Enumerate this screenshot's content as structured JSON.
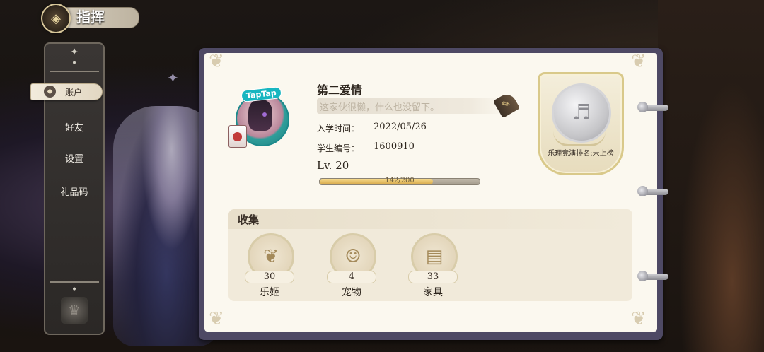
{
  "header": {
    "title": "指挥",
    "emblem_icon": "compass-emblem-icon"
  },
  "menu": {
    "items": [
      {
        "label": "账户",
        "active": true
      },
      {
        "label": "好友",
        "active": false
      },
      {
        "label": "设置",
        "active": false
      },
      {
        "label": "礼品码",
        "active": false
      }
    ]
  },
  "profile": {
    "avatar_badge": "TapTap",
    "name": "第二爱情",
    "signature_placeholder": "这家伙很懒，什么也没留下。",
    "enroll_label": "入学时间：",
    "enroll_date": "2022/05/26",
    "student_id_label": "学生编号：",
    "student_id": "1600910",
    "level_label": "Lv. 20",
    "xp_current": 142,
    "xp_max": 200,
    "xp_text": "142/200"
  },
  "rank": {
    "text": "乐理竞演排名:未上榜"
  },
  "collection": {
    "title": "收集",
    "items": [
      {
        "icon": "rabbit-icon",
        "count": "30",
        "label": "乐姬"
      },
      {
        "icon": "lucky-cat-icon",
        "count": "4",
        "label": "宠物"
      },
      {
        "icon": "bookshelf-icon",
        "count": "33",
        "label": "家具"
      }
    ]
  },
  "colors": {
    "book_frame": "#4e4964",
    "page": "#fbf8ef",
    "xp_fill": "#d7a94a"
  }
}
